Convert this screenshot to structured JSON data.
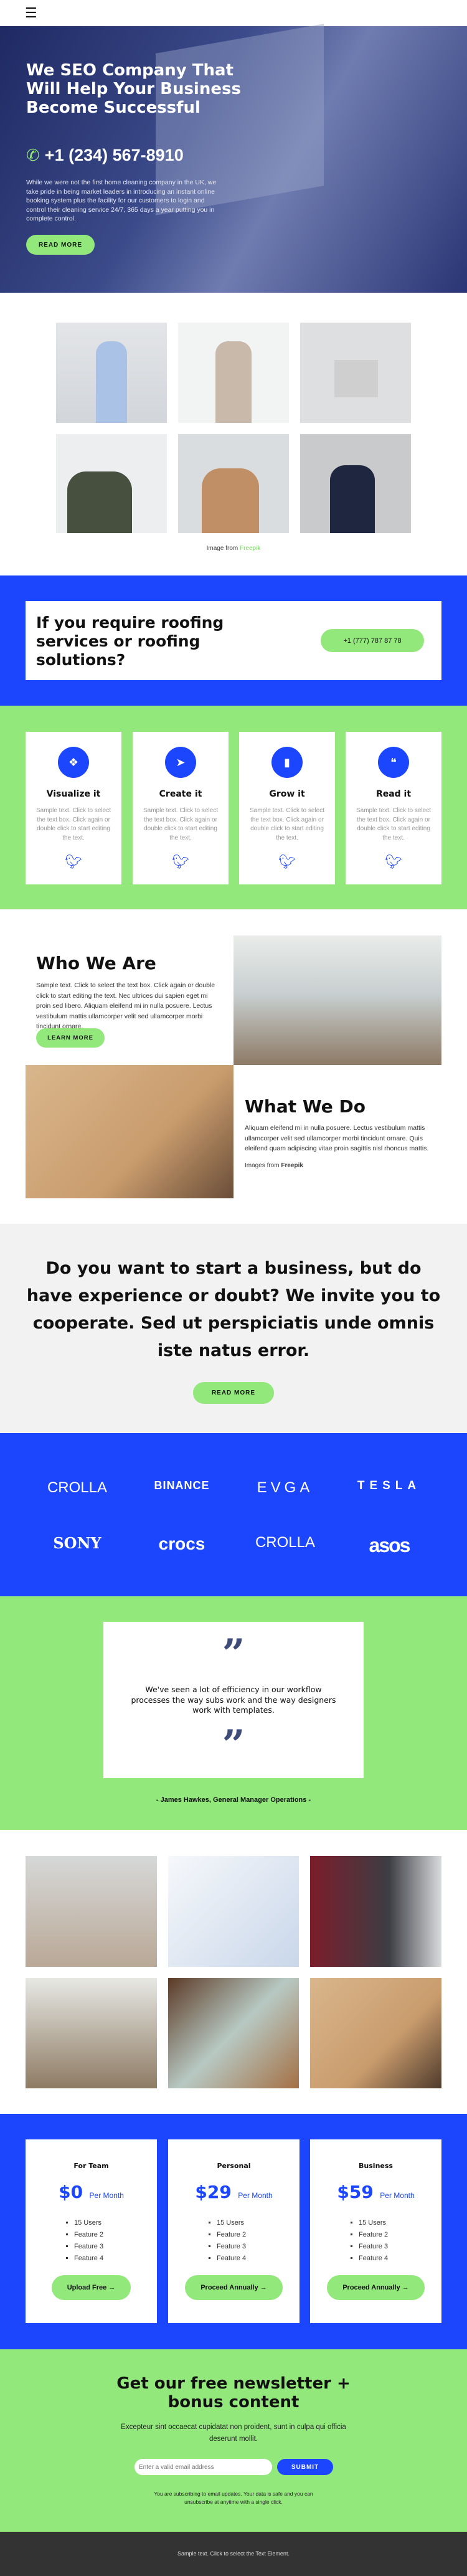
{
  "colors": {
    "blue": "#1c46fe",
    "green": "#93e87c",
    "dark": "#333333",
    "gray": "#f2f2f2"
  },
  "header": {
    "menu_icon": "hamburger-icon"
  },
  "hero": {
    "title": "We SEO Company That Will Help Your Business Become Successful",
    "phone": "+1 (234) 567-8910",
    "text": "While we were not the first home cleaning company in the UK, we take pride in being market leaders in introducing an instant online booking system plus the facility for our customers to login and control their cleaning service 24/7, 365 days a year putting you in complete control.",
    "button": "READ MORE"
  },
  "team": {
    "caption_prefix": "Image from",
    "caption_link": "Freepik"
  },
  "cta": {
    "title": "If you require roofing services or roofing solutions?",
    "phone_button": "+1 (777) 787 87 78"
  },
  "features": [
    {
      "icon": "shapes-icon",
      "title": "Visualize it",
      "text": "Sample text. Click to select the text box. Click again or double click to start editing the text."
    },
    {
      "icon": "cursor-icon",
      "title": "Create it",
      "text": "Sample text. Click to select the text box. Click again or double click to start editing the text."
    },
    {
      "icon": "chart-growth-icon",
      "title": "Grow it",
      "text": "Sample text. Click to select the text box. Click again or double click to start editing the text."
    },
    {
      "icon": "quote-icon",
      "title": "Read it",
      "text": "Sample text. Click to select the text box. Click again or double click to start editing the text."
    }
  ],
  "who": {
    "title": "Who We Are",
    "text": "Sample text. Click to select the text box. Click again or double click to start editing the text. Nec ultrices dui sapien eget mi proin sed libero. Aliquam eleifend mi in nulla posuere. Lectus vestibulum mattis ullamcorper velit sed ullamcorper morbi tincidunt ornare.",
    "button": "LEARN MORE"
  },
  "what": {
    "title": "What We Do",
    "text": "Aliquam eleifend mi in nulla posuere. Lectus vestibulum mattis ullamcorper velit sed ullamcorper morbi tincidunt ornare. Quis eleifend quam adipiscing vitae proin sagittis nisl rhoncus mattis.",
    "caption_prefix": "Images from",
    "caption_link": "Freepik"
  },
  "business": {
    "title": "Do you want to start a business, but do have experience or doubt? We invite you to cooperate. Sed ut perspiciatis unde omnis iste natus error.",
    "button": "READ MORE"
  },
  "logos": [
    "CROLLA",
    "BINANCE",
    "EVGA",
    "TESLA",
    "SONY",
    "crocs",
    "CROLLA",
    "asos"
  ],
  "testimonial": {
    "quote": "We've seen a lot of efficiency in our workflow processes the way subs work and the way designers work with templates.",
    "author": "- James Hawkes, General Manager Operations -"
  },
  "pricing": [
    {
      "name": "For Team",
      "price": "$0",
      "period": "Per Month",
      "features": [
        "15 Users",
        "Feature 2",
        "Feature 3",
        "Feature 4"
      ],
      "button": "Upload Free →"
    },
    {
      "name": "Personal",
      "price": "$29",
      "period": "Per Month",
      "features": [
        "15 Users",
        "Feature 2",
        "Feature 3",
        "Feature 4"
      ],
      "button": "Proceed Annually →"
    },
    {
      "name": "Business",
      "price": "$59",
      "period": "Per Month",
      "features": [
        "15 Users",
        "Feature 2",
        "Feature 3",
        "Feature 4"
      ],
      "button": "Proceed Annually →"
    }
  ],
  "newsletter": {
    "title": "Get our free newsletter + bonus content",
    "text": "Excepteur sint occaecat cupidatat non proident, sunt in culpa qui officia deserunt mollit.",
    "placeholder": "Enter a valid email address",
    "submit": "SUBMIT",
    "disclaimer": "You are subscribing to email updates. Your data is safe and you can unsubscribe at anytime with a single click."
  },
  "footer": {
    "text": "Sample text. Click to select the Text Element."
  }
}
